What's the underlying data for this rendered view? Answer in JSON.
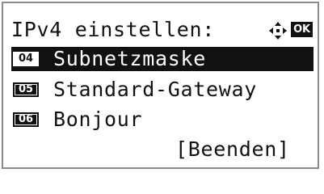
{
  "header": {
    "title": "IPv4 einstellen:",
    "nav_icon": "four-way-arrow-icon",
    "ok_label": "OK"
  },
  "menu": {
    "items": [
      {
        "number": "04",
        "label": "Subnetzmaske",
        "selected": true
      },
      {
        "number": "05",
        "label": "Standard-Gateway",
        "selected": false
      },
      {
        "number": "06",
        "label": "Bonjour",
        "selected": false
      }
    ]
  },
  "footer": {
    "button_label": "[Beenden]"
  },
  "colors": {
    "foreground": "#111111",
    "background": "#ffffff",
    "frame": "#8a8a8a",
    "selected_background": "#111111",
    "selected_foreground": "#ffffff"
  }
}
